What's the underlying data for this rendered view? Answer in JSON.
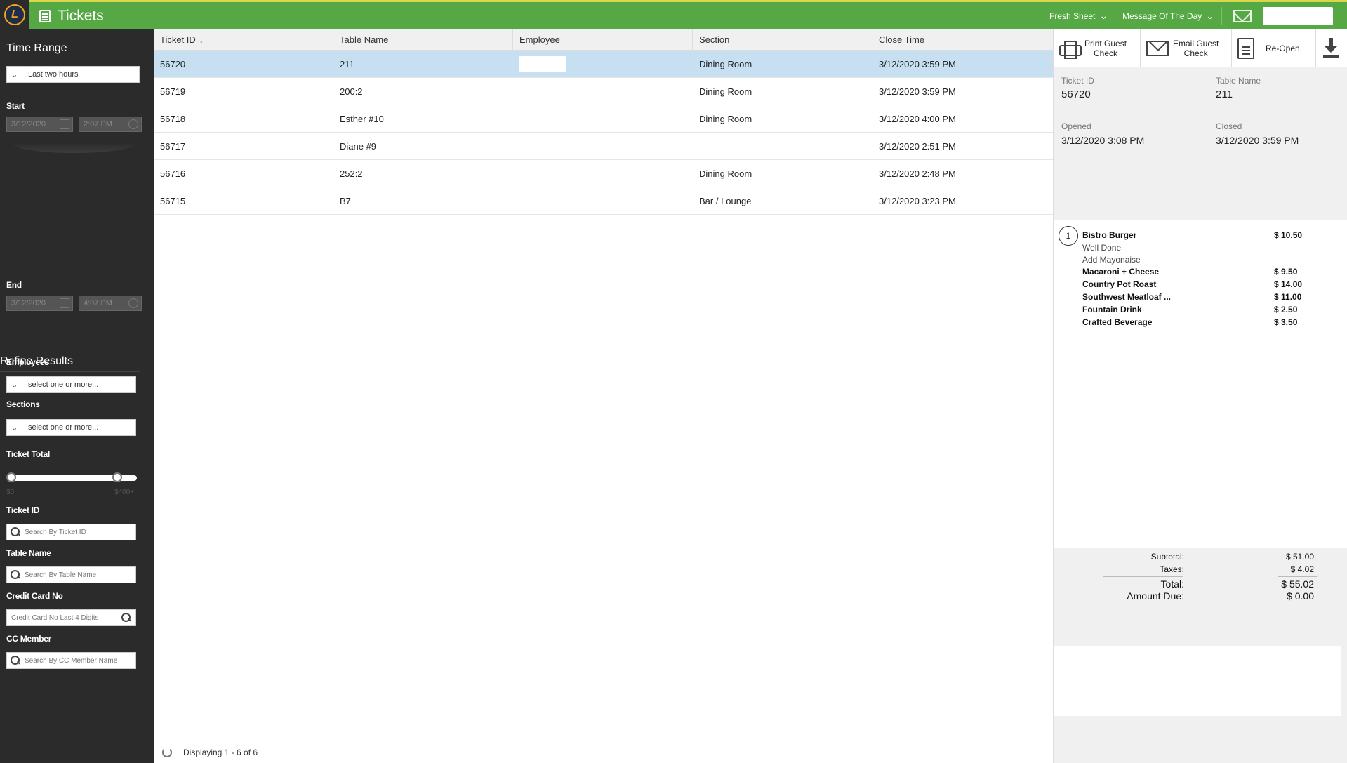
{
  "header": {
    "app_title": "Tickets",
    "logo_letter": "L",
    "menus": [
      {
        "label": "Fresh Sheet"
      },
      {
        "label": "Message Of The Day"
      }
    ]
  },
  "sidebar": {
    "time_range_title": "Time Range",
    "time_range_value": "Last two hours",
    "start_label": "Start",
    "start_date": "3/12/2020",
    "start_time": "2:07 PM",
    "end_label": "End",
    "end_date": "3/12/2020",
    "end_time": "4:07 PM",
    "refine_title": "Refine Results",
    "employees_label": "Employees",
    "employees_placeholder": "select one or more...",
    "sections_label": "Sections",
    "sections_placeholder": "select one or more...",
    "ticket_total_label": "Ticket Total",
    "slider_min_label": "$0",
    "slider_max_label": "$400+",
    "slider_range": [
      0,
      400
    ],
    "ticket_id_label": "Ticket ID",
    "ticket_id_placeholder": "Search By Ticket ID",
    "table_name_label": "Table Name",
    "table_name_placeholder": "Search By Table Name",
    "credit_card_label": "Credit Card No",
    "credit_card_placeholder": "Credit Card No Last 4 Digits",
    "cc_member_label": "CC Member",
    "cc_member_placeholder": "Search By CC Member Name"
  },
  "grid": {
    "columns": [
      "Ticket ID",
      "Table Name",
      "Employee",
      "Section",
      "Close Time"
    ],
    "sort_indicator": "↓",
    "rows": [
      {
        "ticket_id": "56720",
        "table": "211",
        "employee": "",
        "section": "Dining Room",
        "close_time": "3/12/2020 3:59 PM",
        "selected": true
      },
      {
        "ticket_id": "56719",
        "table": "200:2",
        "employee": "",
        "section": "Dining Room",
        "close_time": "3/12/2020 3:59 PM"
      },
      {
        "ticket_id": "56718",
        "table": "Esther #10",
        "employee": "",
        "section": "Dining Room",
        "close_time": "3/12/2020 4:00 PM"
      },
      {
        "ticket_id": "56717",
        "table": "Diane #9",
        "employee": "",
        "section": "",
        "close_time": "3/12/2020 2:51 PM"
      },
      {
        "ticket_id": "56716",
        "table": "252:2",
        "employee": "",
        "section": "Dining Room",
        "close_time": "3/12/2020 2:48 PM"
      },
      {
        "ticket_id": "56715",
        "table": "B7",
        "employee": "",
        "section": "Bar / Lounge",
        "close_time": "3/12/2020 3:23 PM"
      }
    ],
    "footer_text": "Displaying 1 - 6 of 6"
  },
  "detail": {
    "actions": {
      "print_line1": "Print Guest",
      "print_line2": "Check",
      "email_line1": "Email Guest",
      "email_line2": "Check",
      "reopen": "Re-Open"
    },
    "ticket_id_label": "Ticket ID",
    "ticket_id": "56720",
    "table_name_label": "Table Name",
    "table_name": "211",
    "opened_label": "Opened",
    "opened": "3/12/2020 3:08 PM",
    "closed_label": "Closed",
    "closed": "3/12/2020 3:59 PM",
    "seat_number": "1",
    "items": [
      {
        "name": "Bistro Burger",
        "price": "$ 10.50",
        "bold": true
      },
      {
        "name": "Well Done",
        "price": "",
        "bold": false
      },
      {
        "name": "Add Mayonaise",
        "price": "",
        "bold": false
      },
      {
        "name": "Macaroni + Cheese",
        "price": "$ 9.50",
        "bold": true
      },
      {
        "name": "Country Pot Roast",
        "price": "$ 14.00",
        "bold": true
      },
      {
        "name": "Southwest Meatloaf ...",
        "price": "$ 11.00",
        "bold": true
      },
      {
        "name": "Fountain Drink",
        "price": "$ 2.50",
        "bold": true
      },
      {
        "name": "Crafted Beverage",
        "price": "$ 3.50",
        "bold": true
      }
    ],
    "totals": {
      "subtotal_label": "Subtotal:",
      "subtotal": "$ 51.00",
      "taxes_label": "Taxes:",
      "taxes": "$ 4.02",
      "total_label": "Total:",
      "total": "$ 55.02",
      "amount_due_label": "Amount Due:",
      "amount_due": "$ 0.00"
    }
  },
  "colors": {
    "topbar": "#55a844",
    "sidebar": "#2b2b2b",
    "selected_row": "#c6dff1",
    "panel_bg": "#f0f0f0"
  }
}
